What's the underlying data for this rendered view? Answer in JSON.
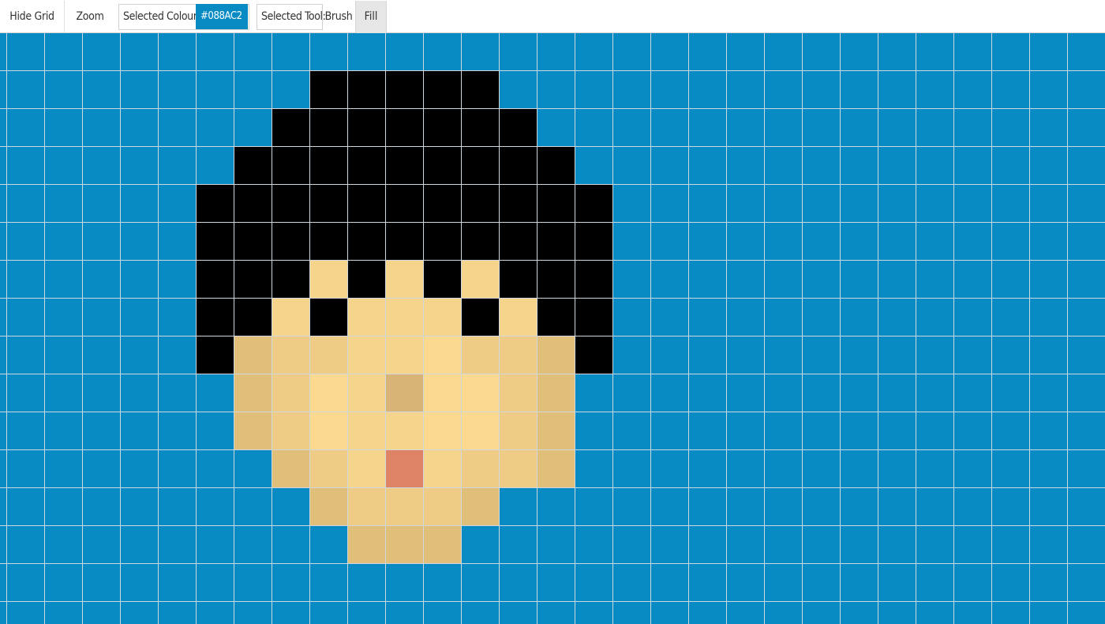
{
  "toolbar": {
    "hide_grid_label": "Hide Grid",
    "zoom_label": "Zoom",
    "selected_colour_label": "Selected Colour:",
    "selected_colour_value": "#088AC2",
    "selected_tool_label": "Selected Tool:",
    "tools": [
      "Brush",
      "Fill"
    ],
    "active_tool": "Fill"
  },
  "canvas": {
    "palette": {
      "B": "#088ac2",
      "K": "#000000",
      "1": "#e0bf7b",
      "2": "#efcc86",
      "3": "#f5d58c",
      "4": "#fbd98f",
      "5": "#d8b577",
      "6": "#df8367"
    },
    "pixels": [
      "BBBBBBBBBBBBBBBBBBBBBBBBBBBBBB",
      "BBBBBBBBBKKKKKBBBBBBBBBBBBBBBB",
      "BBBBBBBBKKKKKKKBBBBBBBBBBBBBBB",
      "BBBBBBBKKKKKKKKKBBBBBBBBBBBBBB",
      "BBBBBBKKKKKKKKKKKBBBBBBBBBBBBB",
      "BBBBBBKKKKKKKKKKKBBBBBBBBBBBBB",
      "BBBBBBKKK3K3K3KKKBBBBBBBBBBBBB",
      "BBBBBBKK3K333K3KKBBBBBBBBBBBBB",
      "BBBBBBK122334221KBBBBBBBBBBBBB",
      "BBBBBBB124354421BBBBBBBBBBBBBB",
      "BBBBBBB124334421BBBBBBBBBBBBBB",
      "BBBBBBBB12363221BBBBBBBBBBBBBB",
      "BBBBBBBBB12221BBBBBBBBBBBBBBBB",
      "BBBBBBBBBB111BBBBBBBBBBBBBBBBB",
      "BBBBBBBBBBBBBBBBBBBBBBBBBBBBBB",
      "BBBBBBBBBBBBBBBBBBBBBBBBBBBBBB"
    ]
  }
}
